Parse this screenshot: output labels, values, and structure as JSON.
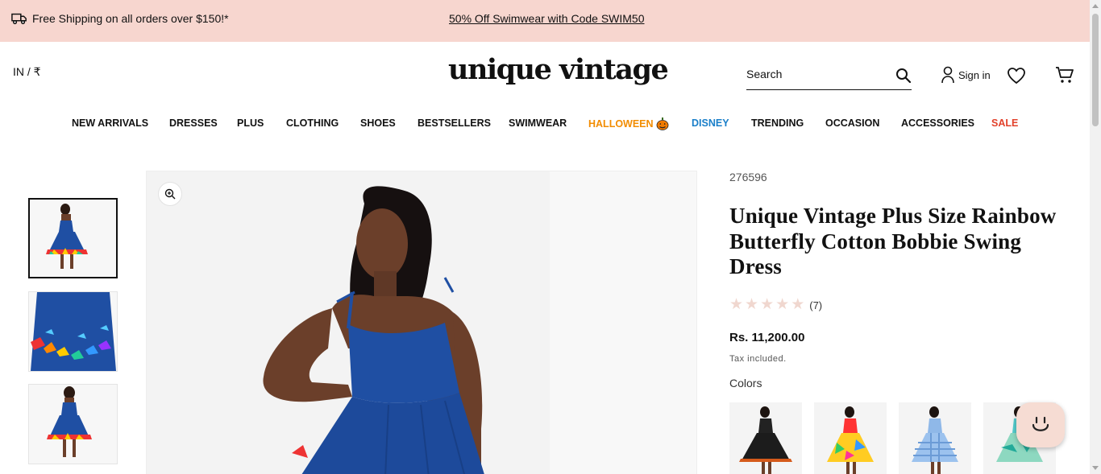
{
  "promo": {
    "left_text": "Free Shipping on all orders over $150!*",
    "center_link": "50% Off Swimwear with Code SWIM50"
  },
  "header": {
    "locale": "IN / ₹",
    "logo": "unique vintage",
    "search_placeholder": "Search",
    "signin": "Sign in"
  },
  "nav": [
    {
      "label": "NEW ARRIVALS",
      "color": "#111111"
    },
    {
      "label": "DRESSES",
      "color": "#111111"
    },
    {
      "label": "PLUS",
      "color": "#111111"
    },
    {
      "label": "CLOTHING",
      "color": "#111111"
    },
    {
      "label": "SHOES",
      "color": "#111111"
    },
    {
      "label": "BESTSELLERS",
      "color": "#111111"
    },
    {
      "label": "SWIMWEAR",
      "color": "#111111"
    },
    {
      "label": "HALLOWEEN",
      "color": "#f28c00",
      "icon": "pumpkin-icon"
    },
    {
      "label": "DISNEY",
      "color": "#1a7fc9"
    },
    {
      "label": "TRENDING",
      "color": "#111111"
    },
    {
      "label": "OCCASION",
      "color": "#111111"
    },
    {
      "label": "ACCESSORIES",
      "color": "#111111"
    },
    {
      "label": "SALE",
      "color": "#e2412b"
    }
  ],
  "product": {
    "sku": "276596",
    "title": "Unique Vintage Plus Size Rainbow Butterfly Cotton Bobbie Swing Dress",
    "rating": 0,
    "rating_max": 5,
    "review_count": "(7)",
    "price": "Rs. 11,200.00",
    "tax_note": "Tax included.",
    "colors_label": "Colors"
  },
  "colors": {
    "accent": "#f7d6cf",
    "dress_blue": "#1f4fa3"
  }
}
